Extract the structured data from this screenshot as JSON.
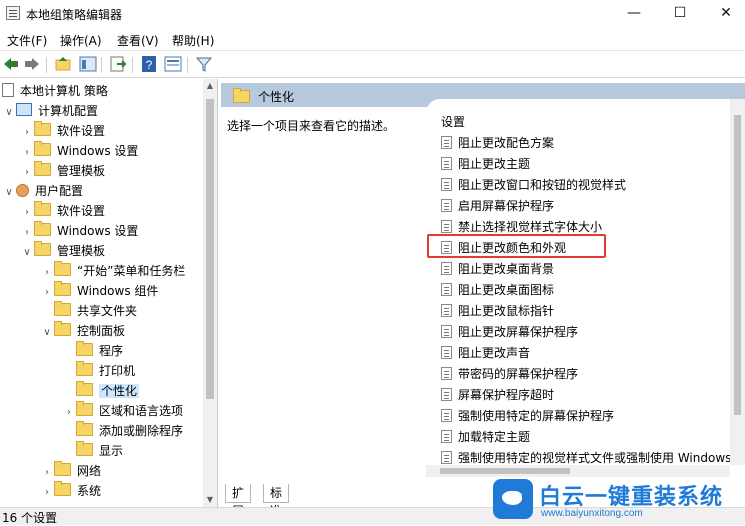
{
  "window": {
    "title": "本地组策略编辑器",
    "minimize": "—",
    "maximize": "☐",
    "close": "✕"
  },
  "menu": [
    "文件(F)",
    "操作(A)",
    "查看(V)",
    "帮助(H)"
  ],
  "tree": {
    "root": "本地计算机 策略",
    "computer_config": "计算机配置",
    "software_settings_1": "软件设置",
    "windows_settings_1": "Windows 设置",
    "admin_templates_1": "管理模板",
    "user_config": "用户配置",
    "software_settings_2": "软件设置",
    "windows_settings_2": "Windows 设置",
    "admin_templates_2": "管理模板",
    "start_menu": "“开始”菜单和任务栏",
    "windows_components": "Windows 组件",
    "shared_folders": "共享文件夹",
    "control_panel": "控制面板",
    "programs": "程序",
    "printers": "打印机",
    "personalization": "个性化",
    "regional": "区域和语言选项",
    "add_remove": "添加或删除程序",
    "display": "显示",
    "network": "网络",
    "system": "系统"
  },
  "right": {
    "header": "个性化",
    "description": "选择一个项目来查看它的描述。",
    "column_header": "设置",
    "settings": [
      "阻止更改配色方案",
      "阻止更改主题",
      "阻止更改窗口和按钮的视觉样式",
      "启用屏幕保护程序",
      "禁止选择视觉样式字体大小",
      "阻止更改颜色和外观",
      "阻止更改桌面背景",
      "阻止更改桌面图标",
      "阻止更改鼠标指针",
      "阻止更改屏幕保护程序",
      "阻止更改声音",
      "带密码的屏幕保护程序",
      "屏幕保护程序超时",
      "强制使用特定的屏幕保护程序",
      "加载特定主题",
      "强制使用特定的视觉样式文件或强制使用 Windows"
    ],
    "highlighted_index": 5
  },
  "tabs": [
    "扩展",
    "标准"
  ],
  "status": "16 个设置",
  "watermark": {
    "cn": "白云一键重装系统",
    "en": "www.baiyunxitong.com"
  },
  "colors": {
    "header_band": "#b7c9dd",
    "highlight_border": "#e53935",
    "selection": "#cce8ff",
    "watermark": "#1f7ad8"
  }
}
